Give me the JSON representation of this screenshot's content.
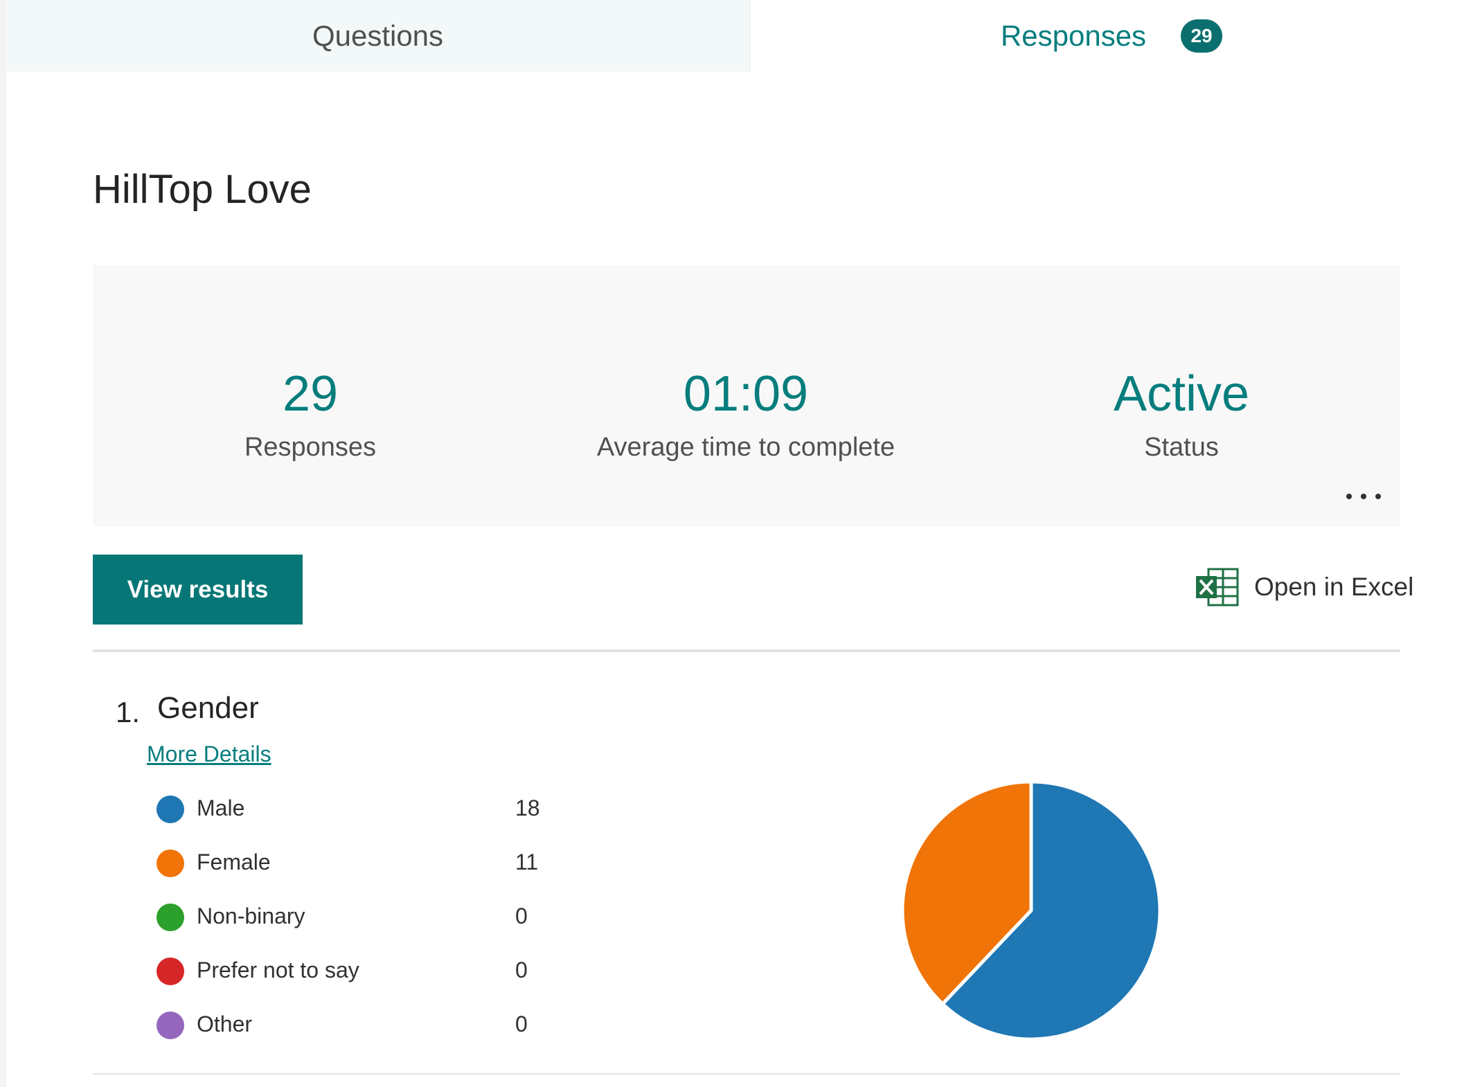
{
  "tabs": {
    "questions_label": "Questions",
    "responses_label": "Responses",
    "responses_count": "29"
  },
  "form": {
    "title": "HillTop Love"
  },
  "stats": {
    "responses_value": "29",
    "responses_label": "Responses",
    "avg_time_value": "01:09",
    "avg_time_label": "Average time to complete",
    "status_value": "Active",
    "status_label": "Status",
    "more_icon": "more-ellipsis-icon"
  },
  "actions": {
    "view_results_label": "View results",
    "open_excel_label": "Open in Excel",
    "excel_icon": "excel-icon"
  },
  "question": {
    "number": "1.",
    "title": "Gender",
    "more_details_label": "More Details",
    "options": [
      {
        "label": "Male",
        "count": "18",
        "color": "#1f77b4"
      },
      {
        "label": "Female",
        "count": "11",
        "color": "#f07407"
      },
      {
        "label": "Non-binary",
        "count": "0",
        "color": "#2ca02c"
      },
      {
        "label": "Prefer not to say",
        "count": "0",
        "color": "#d62728"
      },
      {
        "label": "Other",
        "count": "0",
        "color": "#9467bd"
      }
    ]
  },
  "chart_data": {
    "type": "pie",
    "categories": [
      "Male",
      "Female",
      "Non-binary",
      "Prefer not to say",
      "Other"
    ],
    "values": [
      18,
      11,
      0,
      0,
      0
    ],
    "colors": [
      "#1f77b4",
      "#f07407",
      "#2ca02c",
      "#d62728",
      "#9467bd"
    ]
  },
  "colors": {
    "accent": "#077d7d",
    "button_bg": "#077676"
  }
}
